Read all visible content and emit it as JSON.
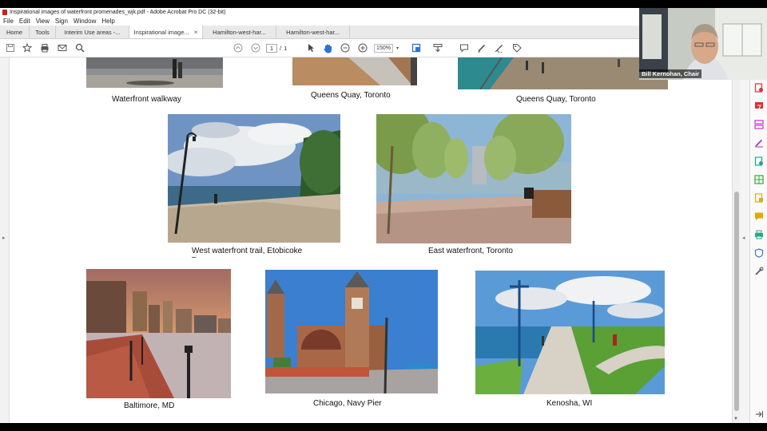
{
  "window": {
    "title": "Inspirational images of waterfront promenades_wjk.pdf - Adobe Acrobat Pro DC (32-bit)"
  },
  "menu": [
    "File",
    "Edit",
    "View",
    "Sign",
    "Window",
    "Help"
  ],
  "tabs": {
    "home": "Home",
    "tools": "Tools",
    "documents": [
      {
        "label": "Interim Use areas -...",
        "active": false
      },
      {
        "label": "Inspirational image...",
        "active": true
      },
      {
        "label": "Hamilton-west-har...",
        "active": false
      },
      {
        "label": "Hamilton-west-har...",
        "active": false
      }
    ],
    "close_glyph": "×"
  },
  "toolbar": {
    "page_current": "1",
    "page_separator": "/",
    "page_total": "1",
    "zoom": "150%"
  },
  "captions": {
    "waterfront_walkway": "Waterfront walkway",
    "queens_quay_1": "Queens Quay, Toronto",
    "queens_quay_2": "Queens Quay, Toronto",
    "west_trail": "West waterfront trail, Etobicoke",
    "west_trail_mark": "–",
    "east_waterfront": "East waterfront, Toronto",
    "baltimore": "Baltimore, MD",
    "chicago": "Chicago, Navy Pier",
    "kenosha": "Kenosha, WI"
  },
  "webcam": {
    "name": "Bill Kernohan, Chair"
  },
  "icons": {
    "save": "save-icon",
    "bookmark": "star-icon",
    "print": "print-icon",
    "email": "mail-icon",
    "search": "search-icon",
    "prev": "page-up-icon",
    "next": "page-down-icon",
    "select": "select-arrow-icon",
    "hand": "hand-icon",
    "zoom_out": "zoom-out-icon",
    "zoom_in": "zoom-in-icon",
    "marquee": "marquee-icon",
    "read": "read-mode-icon",
    "comment": "comment-icon",
    "pen": "pen-icon",
    "fill_sign": "fill-sign-icon",
    "tag": "tag-icon"
  },
  "colors": {
    "acrobat_red": "#c8201a",
    "tab_active": "#ffffff",
    "tab_inactive": "#e9e9e9"
  }
}
